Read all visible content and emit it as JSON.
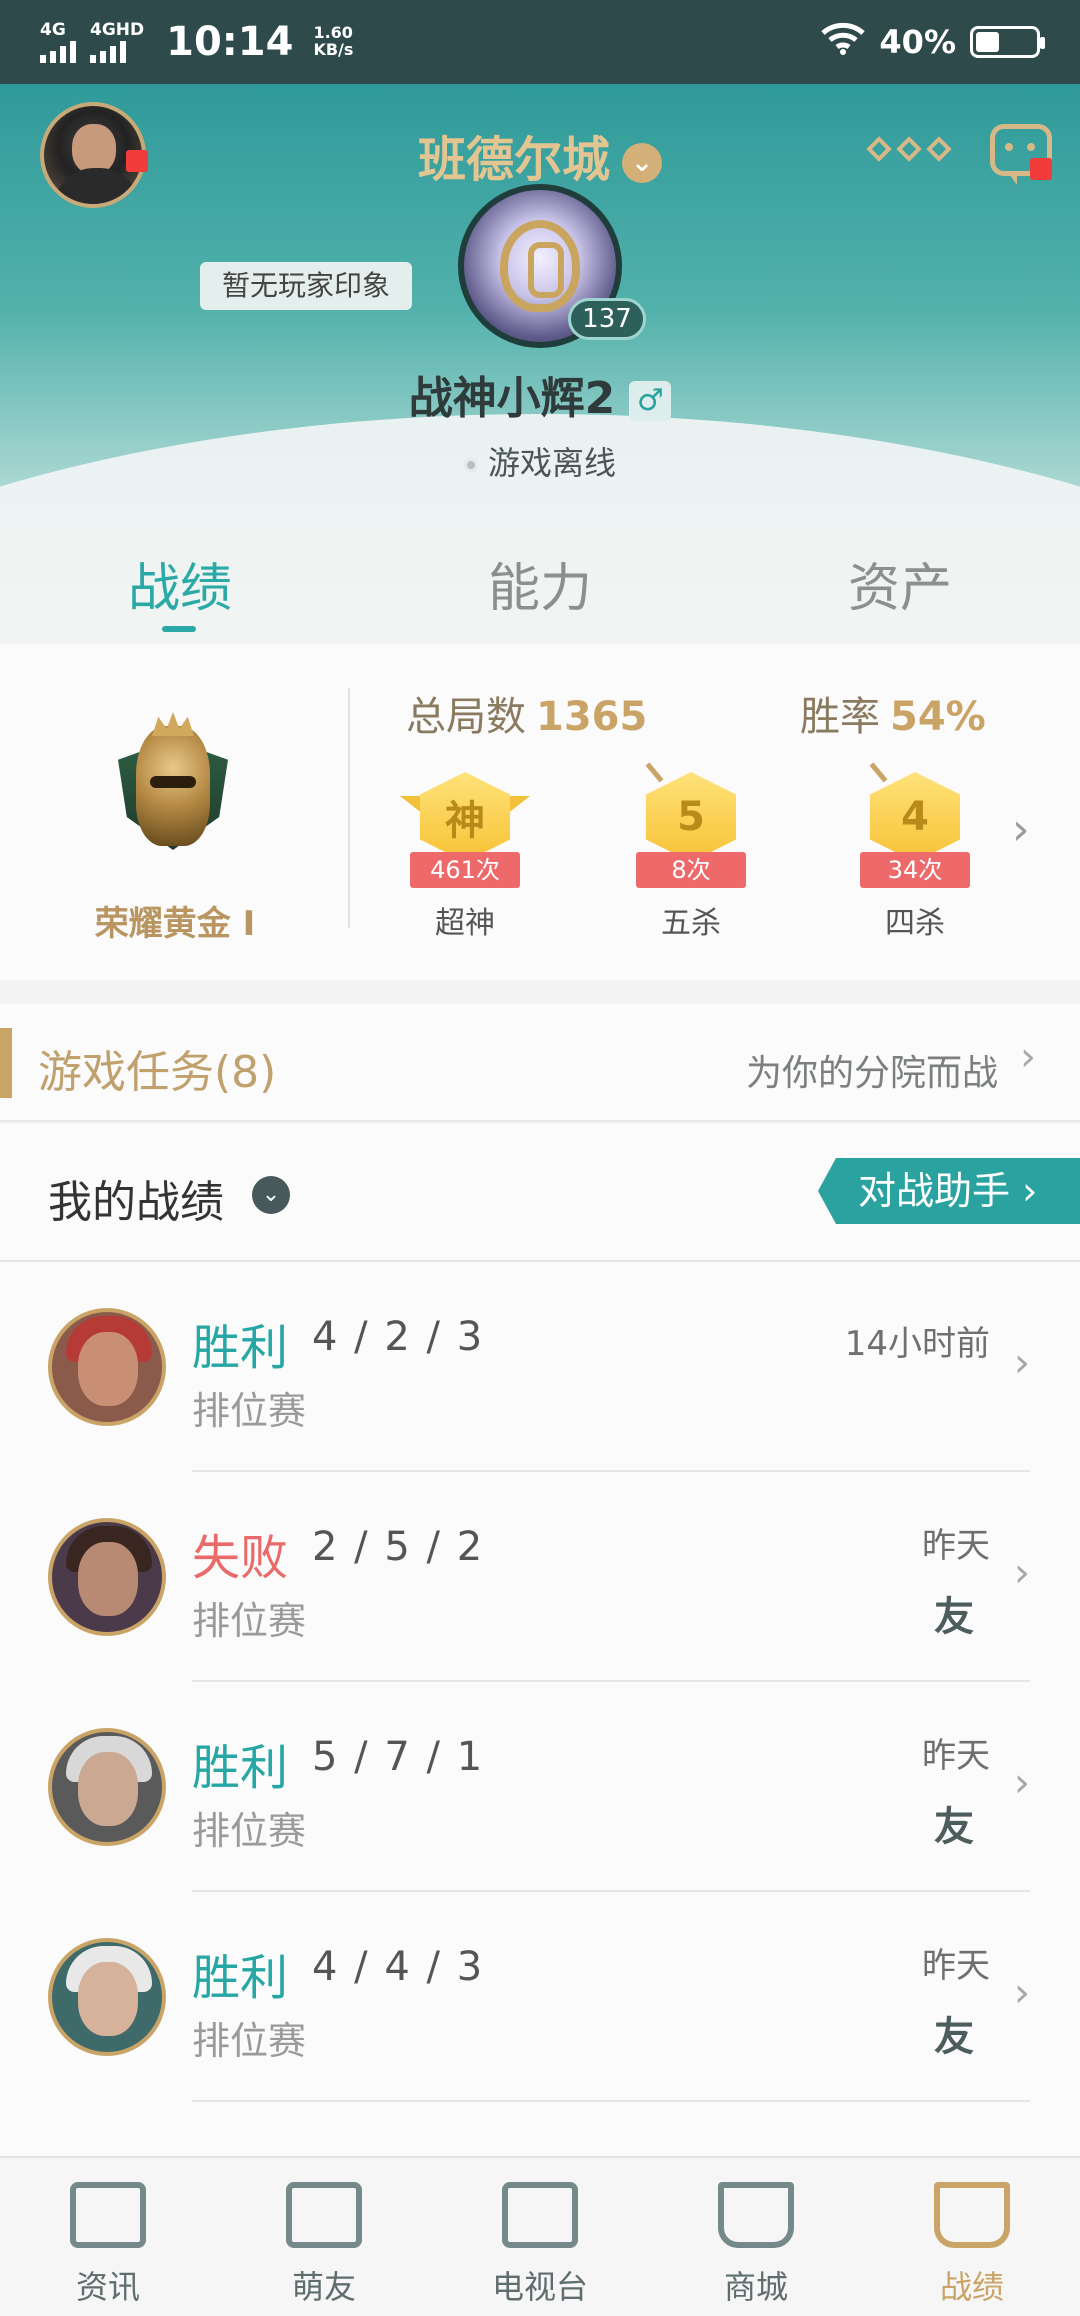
{
  "status_bar": {
    "sig1": "4G",
    "sig2": "4GHD",
    "time": "10:14",
    "speed_value": "1.60",
    "speed_unit": "KB/s",
    "battery": "40%",
    "battery_level": 0.4
  },
  "header": {
    "server": "班德尔城",
    "impression": "暂无玩家印象",
    "level": "137",
    "nickname": "战神小辉2",
    "gender_symbol": "♂",
    "online_status": "游戏离线"
  },
  "tabs": [
    {
      "label": "战绩",
      "active": true
    },
    {
      "label": "能力",
      "active": false
    },
    {
      "label": "资产",
      "active": false
    }
  ],
  "stats": {
    "rank_name": "荣耀黄金 I",
    "total_games_label": "总局数",
    "total_games": "1365",
    "win_rate_label": "胜率",
    "win_rate": "54%",
    "badges": [
      {
        "glyph": "神",
        "count": "461次",
        "label": "超神"
      },
      {
        "glyph": "5",
        "count": "8次",
        "label": "五杀"
      },
      {
        "glyph": "4",
        "count": "34次",
        "label": "四杀"
      }
    ]
  },
  "task": {
    "title": "游戏任务(8)",
    "link": "为你的分院而战"
  },
  "records": {
    "title": "我的战绩",
    "assist_button": "对战助手 ›"
  },
  "matches": [
    {
      "result": "胜利",
      "kda": "4 / 2 / 3",
      "mode": "排位赛",
      "time": "14小时前",
      "friend": ""
    },
    {
      "result": "失败",
      "kda": "2 / 5 / 2",
      "mode": "排位赛",
      "time": "昨天",
      "friend": "友"
    },
    {
      "result": "胜利",
      "kda": "5 / 7 / 1",
      "mode": "排位赛",
      "time": "昨天",
      "friend": "友"
    },
    {
      "result": "胜利",
      "kda": "4 / 4 / 3",
      "mode": "排位赛",
      "time": "昨天",
      "friend": "友"
    }
  ],
  "bottom_nav": [
    {
      "label": "资讯",
      "icon": "book-icon"
    },
    {
      "label": "萌友",
      "icon": "chat-heart-icon"
    },
    {
      "label": "电视台",
      "icon": "tv-icon"
    },
    {
      "label": "商城",
      "icon": "shop-bag-icon"
    },
    {
      "label": "战绩",
      "icon": "battle-record-icon",
      "active": true
    }
  ],
  "colors": {
    "teal": "#2aa9a6",
    "gold": "#c9a466",
    "win": "#27a7a3",
    "lose": "#ea6a6a"
  }
}
